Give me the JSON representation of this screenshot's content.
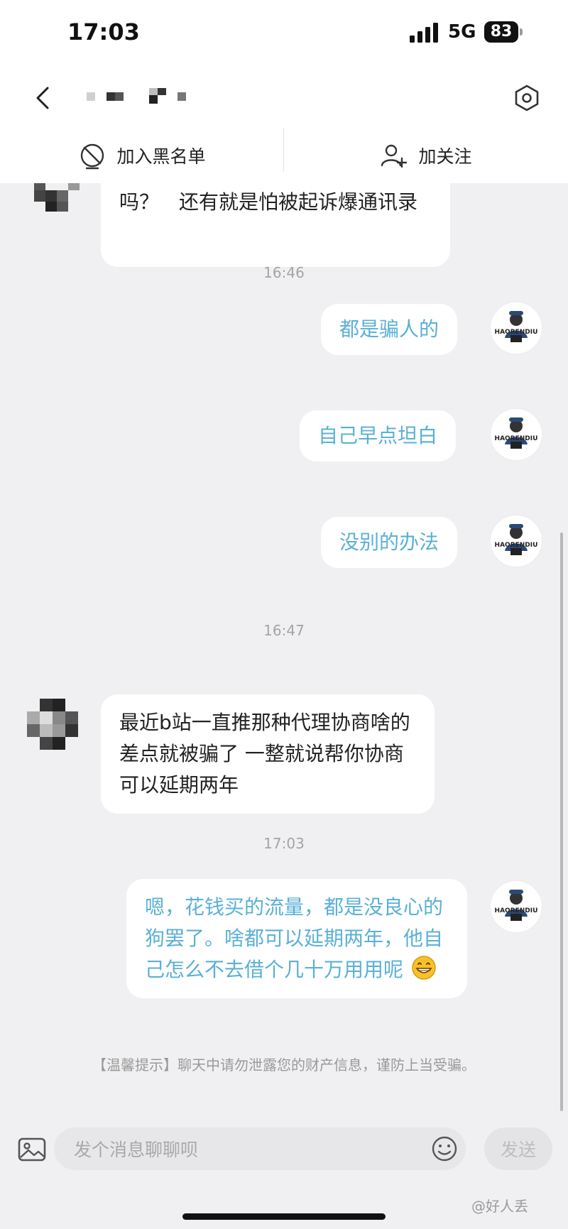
{
  "status": {
    "time": "17:03",
    "network": "5G",
    "battery": "83"
  },
  "header": {
    "back_icon": "chevron-left-icon",
    "settings_icon": "hexagon-settings-icon"
  },
  "actions": [
    {
      "label": "加入黑名单",
      "icon": "blacklist-icon"
    },
    {
      "label": "加关注",
      "icon": "add-follow-icon"
    }
  ],
  "messages": [
    {
      "from": "other",
      "text": "吗？　还有就是怕被起诉爆通讯录",
      "partial_top_hidden": true
    },
    {
      "timestamp": "16:46"
    },
    {
      "from": "me",
      "text": "都是骗人的"
    },
    {
      "from": "me",
      "text": "自己早点坦白"
    },
    {
      "from": "me",
      "text": "没别的办法"
    },
    {
      "timestamp": "16:47"
    },
    {
      "from": "other",
      "text": "最近b站一直推那种代理协商啥的 差点就被骗了 一整就说帮你协商可以延期两年"
    },
    {
      "timestamp": "17:03"
    },
    {
      "from": "me",
      "text": "嗯，花钱买的流量，都是没良心的狗罢了。啥都可以延期两年，他自己怎么不去借个几十万用用呢",
      "emoji": "grinning-face"
    }
  ],
  "self_avatar_text": "HAORENDIU",
  "tip": "【温馨提示】聊天中请勿泄露您的财产信息，谨防上当受骗。",
  "composer": {
    "placeholder": "发个消息聊聊呗",
    "send_label": "发送"
  },
  "watermark": "@好人丢",
  "colors": {
    "accent_text": "#5ab0d6",
    "bubble": "#ffffff",
    "background": "#f0f0f2"
  }
}
